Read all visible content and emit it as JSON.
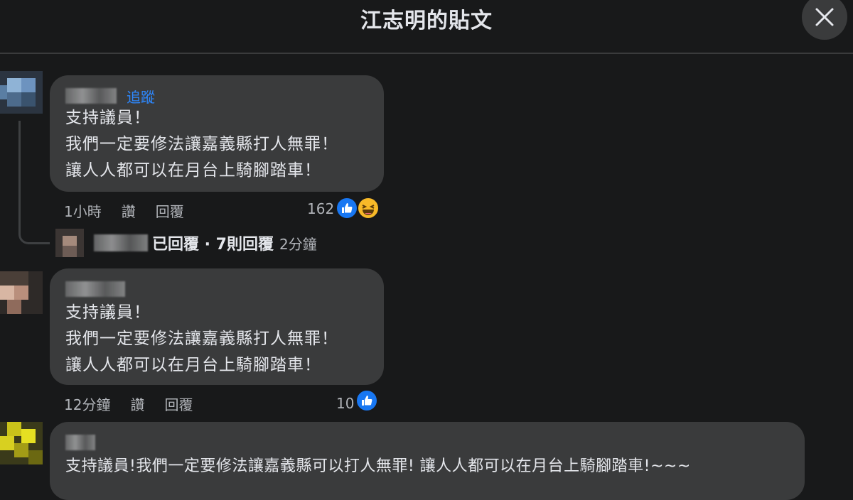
{
  "header": {
    "title": "江志明的貼文"
  },
  "comments": [
    {
      "follow_label": "追蹤",
      "text": "支持議員！\n我們一定要修法讓嘉義縣打人無罪！\n讓人人都可以在月台上騎腳踏車！",
      "time": "1小時",
      "like_label": "讚",
      "reply_label": "回覆",
      "reaction_count": "162"
    },
    {
      "text": "支持議員！\n我們一定要修法讓嘉義縣打人無罪！\n讓人人都可以在月台上騎腳踏車！",
      "time": "12分鐘",
      "like_label": "讚",
      "reply_label": "回覆",
      "reaction_count": "10"
    },
    {
      "text": "支持議員!我們一定要修法讓嘉義縣可以打人無罪! 讓人人都可以在月台上騎腳踏車!~~~"
    }
  ],
  "reply_summary": {
    "text": "已回覆 · 7則回覆",
    "time": "2分鐘"
  },
  "icons": {
    "close": "close-icon",
    "like": "like-icon",
    "haha": "haha-icon"
  },
  "colors": {
    "background": "#18191a",
    "bubble": "#3a3b3c",
    "follow_link": "#2d88ff",
    "like_blue": "#1877f2"
  }
}
